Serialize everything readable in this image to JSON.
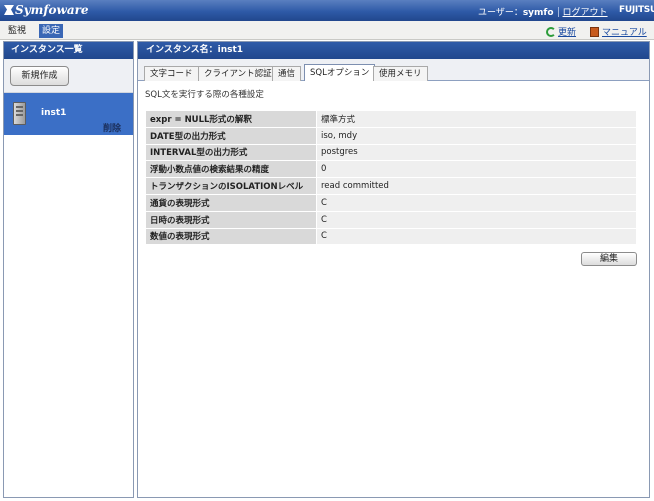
{
  "app": {
    "brand": "Symfoware"
  },
  "user": {
    "label": "ユーザー：",
    "name": "symfo",
    "logout": "ログアウト"
  },
  "vendor": "FUJITSU",
  "menu": {
    "items": [
      {
        "label": "監視"
      },
      {
        "label": "設定"
      }
    ],
    "active": "設定"
  },
  "utilities": {
    "refresh": "更新",
    "manual": "マニュアル"
  },
  "left": {
    "title": "インスタンス一覧",
    "new_button": "新規作成",
    "instances": [
      {
        "name": "inst1",
        "delete_label": "削除"
      }
    ]
  },
  "right": {
    "title": "インスタンス名：inst1",
    "tabs": [
      {
        "label": "文字コード"
      },
      {
        "label": "クライアント認証"
      },
      {
        "label": "通信"
      },
      {
        "label": "SQLオプション"
      },
      {
        "label": "使用メモリ"
      }
    ],
    "active_tab": "SQLオプション",
    "description": "SQL文を実行する際の各種設定",
    "rows": [
      {
        "label": "expr = NULL形式の解釈",
        "value": "標準方式"
      },
      {
        "label": "DATE型の出力形式",
        "value": "iso, mdy"
      },
      {
        "label": "INTERVAL型の出力形式",
        "value": "postgres"
      },
      {
        "label": "浮動小数点値の検索結果の精度",
        "value": "0"
      },
      {
        "label": "トランザクションのISOLATIONレベル",
        "value": "read committed"
      },
      {
        "label": "通貨の表現形式",
        "value": "C"
      },
      {
        "label": "日時の表現形式",
        "value": "C"
      },
      {
        "label": "数値の表現形式",
        "value": "C"
      }
    ],
    "edit_button": "編集"
  },
  "colors": {
    "header": "#2e5aa7",
    "selected": "#3b6fc6",
    "menu_active": "#3a67b5"
  }
}
